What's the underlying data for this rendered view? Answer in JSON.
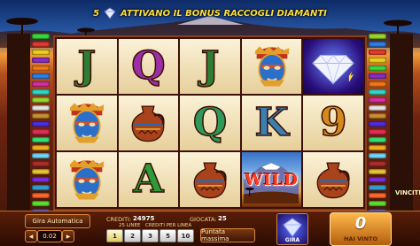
{
  "banner": {
    "count": "5",
    "text": "ATTIVANO IL BONUS RACCOGLI DIAMANTI"
  },
  "reels": [
    [
      {
        "type": "letter",
        "label": "J",
        "color": "#2f7d34"
      },
      {
        "type": "mask"
      },
      {
        "type": "mask"
      }
    ],
    [
      {
        "type": "letter",
        "label": "Q",
        "color": "#9b2fa6"
      },
      {
        "type": "vase"
      },
      {
        "type": "letter",
        "label": "A",
        "color": "#2e9a3a"
      }
    ],
    [
      {
        "type": "letter",
        "label": "J",
        "color": "#2f7d34"
      },
      {
        "type": "letter",
        "label": "Q",
        "color": "#2e9a5a"
      },
      {
        "type": "vase"
      }
    ],
    [
      {
        "type": "mask"
      },
      {
        "type": "letter",
        "label": "K",
        "color": "#3a7fb0"
      },
      {
        "type": "wild",
        "label": "WILD"
      }
    ],
    [
      {
        "type": "diamond"
      },
      {
        "type": "letter",
        "label": "9",
        "color": "#d68a1c"
      },
      {
        "type": "vase"
      }
    ]
  ],
  "paylines_left": [
    "#3cd93c",
    "#e63b2e",
    "#f2d11b",
    "#8a2cc9",
    "#f27a1b",
    "#2e7fe6",
    "#d92ea3",
    "#2ed9c9",
    "#9bd92e",
    "#e6e6e6",
    "#c9932e",
    "#4b2ee6",
    "#e62e5a",
    "#2ee67a",
    "#f2b21b",
    "#6ad9ff",
    "#b02e2e",
    "#e6c92e",
    "#7a2ee6",
    "#2ea3d9",
    "#ff6a2e",
    "#55e62e",
    "#2e55e6",
    "#e62ec9",
    "#c9e62e"
  ],
  "paylines_right": [
    "#9bd92e",
    "#2e7fe6",
    "#e63b2e",
    "#f2d11b",
    "#3cd93c",
    "#8a2cc9",
    "#f27a1b",
    "#2ed9c9",
    "#d92ea3",
    "#e6e6e6",
    "#c9932e",
    "#4b2ee6",
    "#e62e5a",
    "#2ee67a",
    "#f2b21b",
    "#6ad9ff",
    "#b02e2e",
    "#e6c92e",
    "#7a2ee6",
    "#2ea3d9",
    "#ff6a2e",
    "#55e62e",
    "#2e55e6",
    "#e62ec9",
    "#c9e62e"
  ],
  "side_label": "VINCITE",
  "controls": {
    "auto": "Gira Automatica",
    "stepper_minus": "◀",
    "stake": "0.02",
    "stepper_plus": "▶",
    "credits_label": "CREDITI:",
    "credits_value": "24975",
    "bet_label": "GIOCATA:",
    "bet_value": "25",
    "lines_label": "25 LINEE",
    "per_line_label": "CREDITI PER LINEA",
    "line_buttons": [
      "1",
      "2",
      "3",
      "5",
      "10"
    ],
    "max_bet": "Puntata massima",
    "spin": "GIRA",
    "win_value": "0",
    "win_label": "HAI VINTO"
  }
}
